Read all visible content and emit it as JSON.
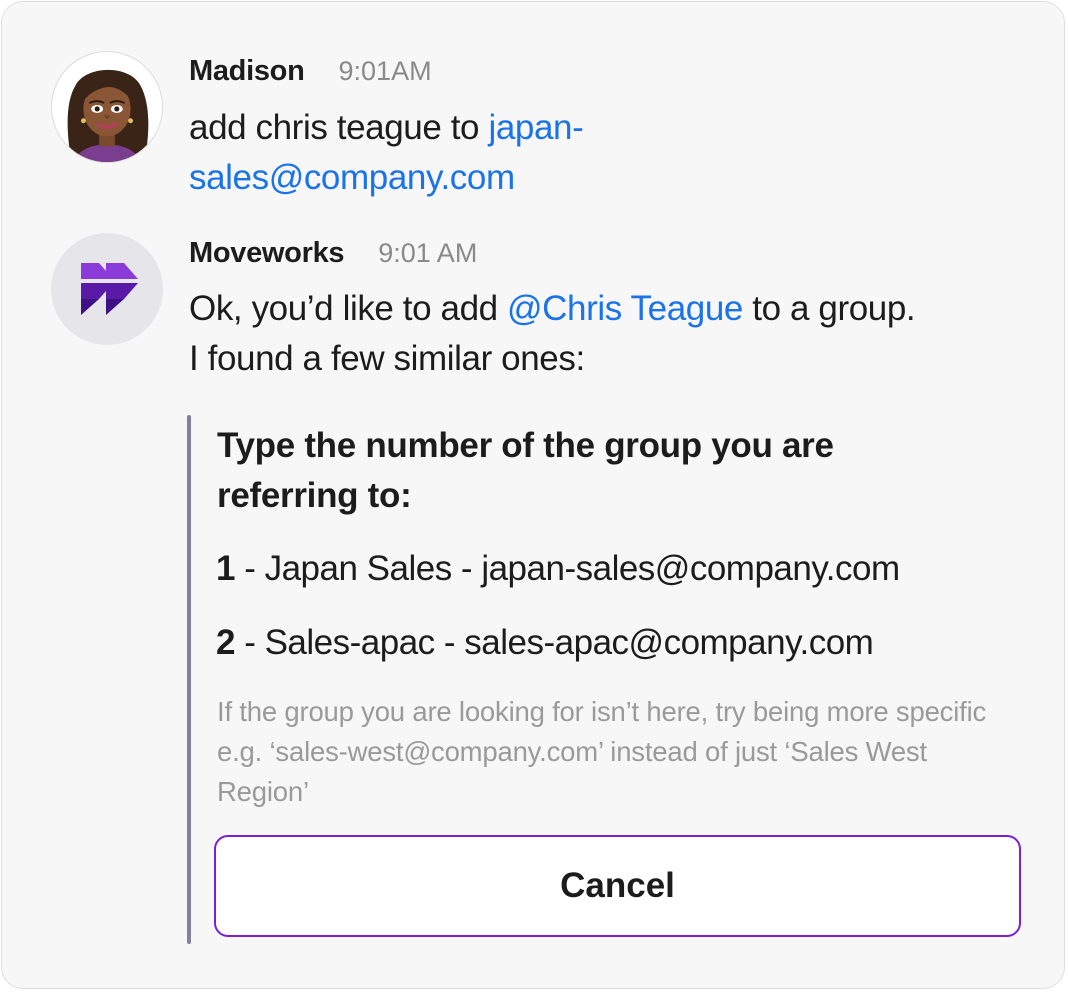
{
  "colors": {
    "link": "#1a73e8",
    "accent_purple": "#7b1fd6",
    "attachment_bar": "#867ea1",
    "card_background": "#f7f7f7"
  },
  "messages": [
    {
      "sender": "Madison",
      "time": "9:01AM",
      "avatar_icon": "bitmoji-avatar-icon",
      "text_before": "add chris teague to ",
      "link": "japan-\nsales@company.com"
    },
    {
      "sender": "Moveworks",
      "time": "9:01 AM",
      "avatar_icon": "moveworks-logo-icon",
      "text_before": "Ok, you’d like to add ",
      "mention": "@Chris Teague",
      "text_after": " to a group.\nI found a few similar ones:"
    }
  ],
  "attachment": {
    "title": "Type the number of the group you are referring to:",
    "options": [
      {
        "number": "1",
        "text": " - Japan Sales - japan-sales@company.com"
      },
      {
        "number": "2",
        "text": " - Sales-apac - sales-apac@company.com"
      }
    ],
    "hint": "If the group you are looking for isn’t here, try being more specific e.g. ‘sales-west@company.com’ instead of just ‘Sales West Region’",
    "cancel_label": "Cancel"
  }
}
